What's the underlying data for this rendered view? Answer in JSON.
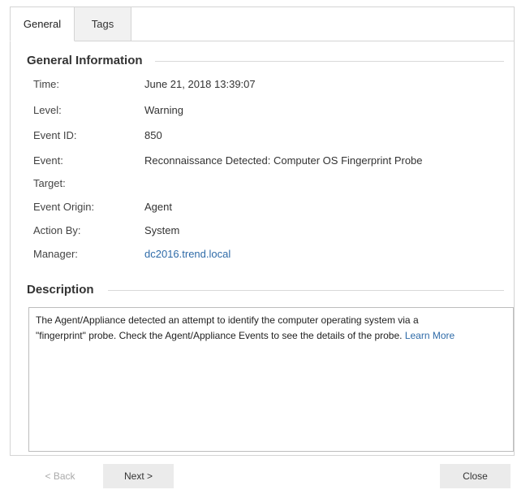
{
  "tabs": {
    "general": "General",
    "tags": "Tags"
  },
  "general_info": {
    "title": "General Information",
    "rows": [
      {
        "label": "Time:",
        "value": "June 21, 2018 13:39:07"
      },
      {
        "label": "Level:",
        "value": "Warning"
      },
      {
        "label": "Event ID:",
        "value": "850"
      },
      {
        "label": "Event:",
        "value": "Reconnaissance Detected: Computer OS Fingerprint Probe"
      },
      {
        "label": "Target:",
        "value": ""
      },
      {
        "label": "Event Origin:",
        "value": "Agent"
      },
      {
        "label": "Action By:",
        "value": "System"
      },
      {
        "label": "Manager:",
        "value": "dc2016.trend.local"
      }
    ]
  },
  "description": {
    "title": "Description",
    "line1": "The Agent/Appliance detected an attempt to identify the computer operating system via a",
    "line2": "\"fingerprint\" probe. Check the Agent/Appliance Events to see the details of the probe.",
    "learn_more": "Learn More"
  },
  "footer": {
    "back": "< Back",
    "next": "Next >",
    "close": "Close"
  },
  "colors": {
    "link": "#2f6ba8",
    "border": "#d4d4d4",
    "button": "#ebebeb"
  }
}
